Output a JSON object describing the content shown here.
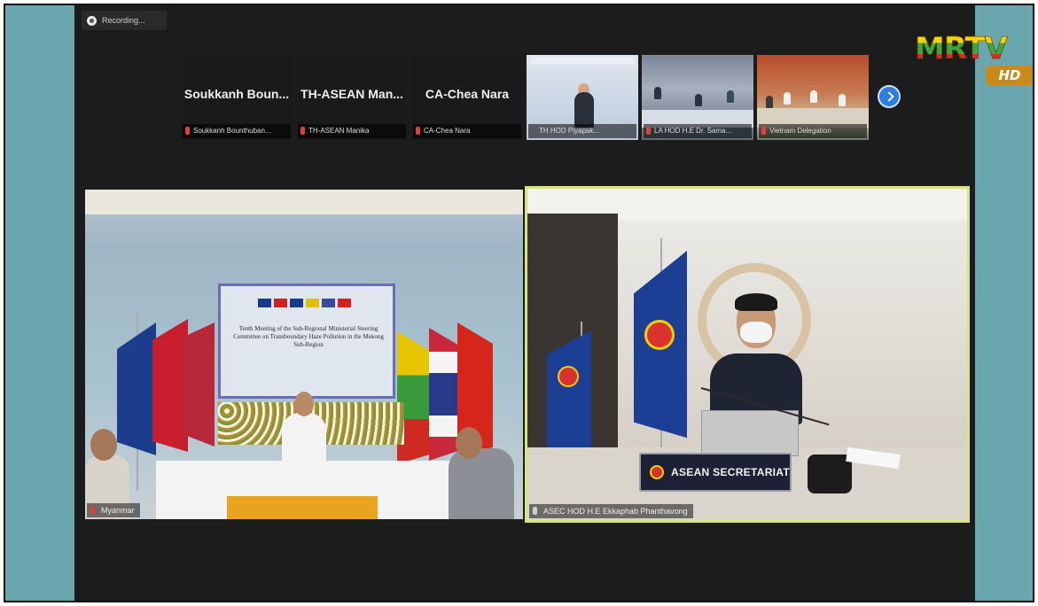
{
  "recording": {
    "label": "Recording..."
  },
  "logo": {
    "brand": "MRTV",
    "badge": "HD"
  },
  "thumbnails": [
    {
      "name": "Soukkanh Boun...",
      "label": "Soukkanh Bounthuban..."
    },
    {
      "name": "TH-ASEAN Man...",
      "label": "TH-ASEAN Manika"
    },
    {
      "name": "CA-Chea Nara",
      "label": "CA-Chea Nara"
    },
    {
      "name": "",
      "label": "TH HOD Piyapak..."
    },
    {
      "name": "",
      "label": "LA HOD H.E Dr. Sama..."
    },
    {
      "name": "",
      "label": "Vietnam Delegation"
    }
  ],
  "main_left": {
    "label": "Myanmar",
    "backdrop_text": "Tenth Meeting of the Sub-Regional Ministerial Steering Committee on Transboundary Haze Pollution in the Mekong Sub-Region"
  },
  "main_right": {
    "label": "ASEC HOD H.E Ekkaphab Phanthavong",
    "nameplate": "ASEAN SECRETARIAT"
  },
  "colors": {
    "side_panel": "#6aa6ad",
    "zoom_background": "#1c1c1c",
    "active_speaker_border": "#d7e67a",
    "next_button": "#2e7de0"
  }
}
